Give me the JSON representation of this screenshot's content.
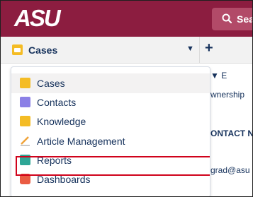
{
  "header": {
    "logo_text": "ASU",
    "search_label": "Sea",
    "brand_color": "#8c1d40"
  },
  "navbar": {
    "app_label": "Cases",
    "caret": "▼",
    "add_symbol": "+"
  },
  "background": {
    "rows": [
      "▼   E",
      "wnership",
      "ONTACT N",
      "grad@asu"
    ]
  },
  "menu": {
    "items": [
      {
        "label": "Cases",
        "icon": "cases-icon",
        "color": "#f4bc25"
      },
      {
        "label": "Contacts",
        "icon": "contacts-icon",
        "color": "#8b80e6"
      },
      {
        "label": "Knowledge",
        "icon": "knowledge-icon",
        "color": "#f4bc25"
      },
      {
        "label": "Article Management",
        "icon": "article-management-icon",
        "color": "#b7b7b7"
      },
      {
        "label": "Reports",
        "icon": "reports-icon",
        "color": "#2ea696"
      },
      {
        "label": "Dashboards",
        "icon": "dashboards-icon",
        "color": "#ea5c43"
      }
    ],
    "highlighted_item": "Reports",
    "highlight_color": "#d0021b"
  }
}
